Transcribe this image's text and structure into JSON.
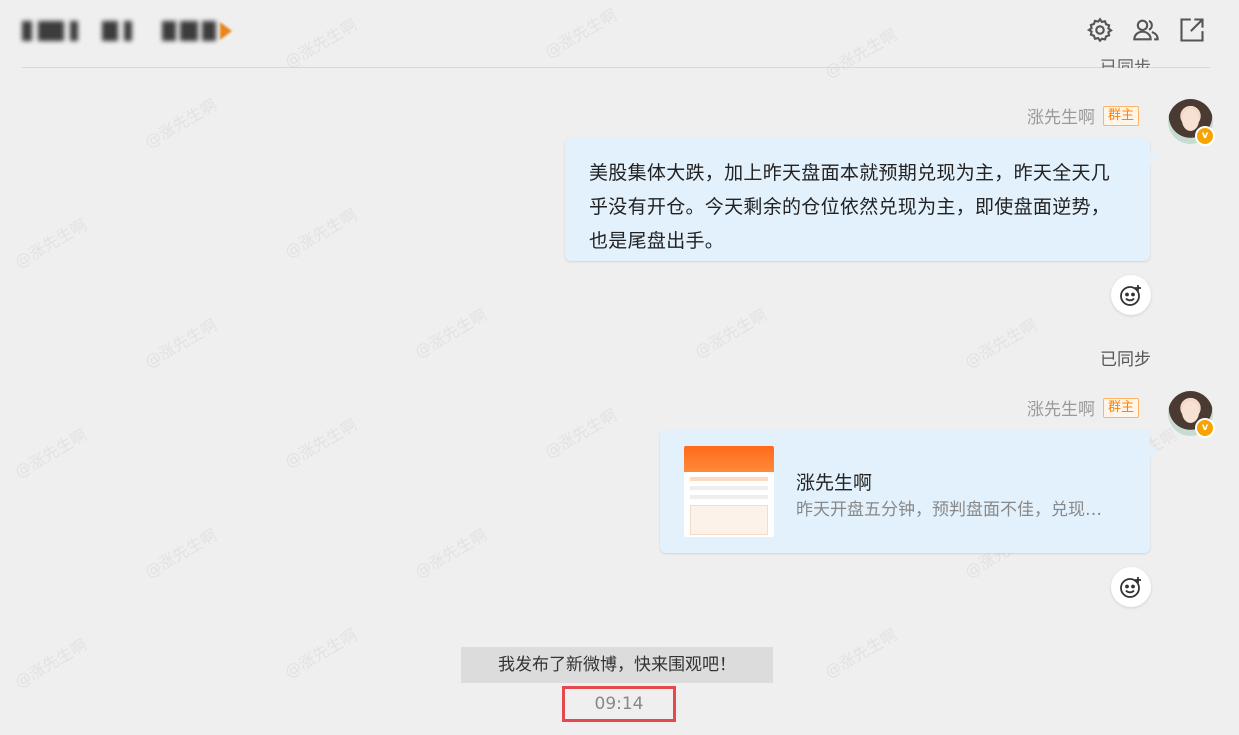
{
  "header": {
    "title": "",
    "icons": [
      "gear-icon",
      "group-members-icon",
      "popout-icon"
    ]
  },
  "status_top_cut": "已同步",
  "messages": [
    {
      "sender": "涨先生啊",
      "badge": "群主",
      "type": "text",
      "text": "美股集体大跌，加上昨天盘面本就预期兑现为主，昨天全天几乎没有开仓。今天剩余的仓位依然兑现为主，即使盘面逆势，也是尾盘出手。"
    },
    {
      "sync_label": "已同步",
      "sender": "涨先生啊",
      "badge": "群主",
      "type": "card",
      "card_title": "涨先生啊",
      "card_desc": "昨天开盘五分钟，预判盘面不佳，兑现…"
    }
  ],
  "system_message": "我发布了新微博，快来围观吧！",
  "timestamp": "09:14",
  "watermark": "@涨先生啊",
  "colors": {
    "background": "#efefef",
    "bubble": "#e3f1fc",
    "owner_badge": "#ff8200",
    "verified_badge": "#f7a300",
    "highlight_box": "#e5484d"
  }
}
